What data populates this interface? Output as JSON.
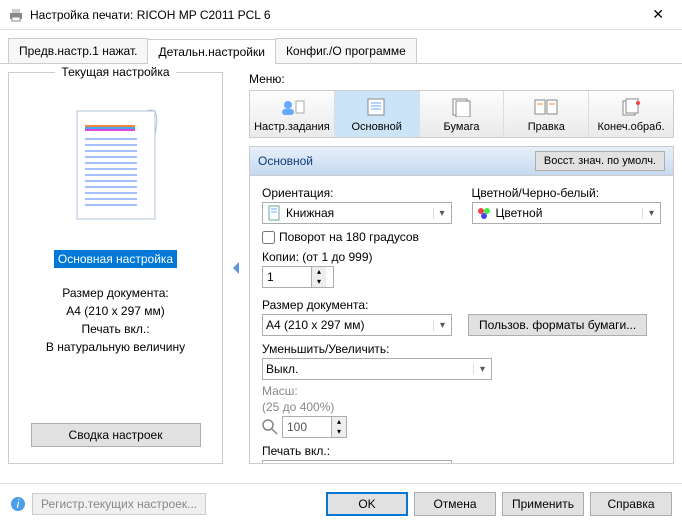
{
  "window": {
    "title": "Настройка печати: RICOH MP C2011 PCL 6"
  },
  "tabs": {
    "preset": "Предв.настр.1 нажат.",
    "detail": "Детальн.настройки",
    "config": "Конфиг./О программе"
  },
  "left": {
    "title": "Текущая настройка",
    "highlight": "Основная настройка",
    "docsize_label": "Размер документа:",
    "docsize_value": "A4 (210 x 297 мм)",
    "printon_label": "Печать вкл.:",
    "printon_value": "В натуральную величину",
    "summary_btn": "Сводка настроек"
  },
  "menu": {
    "label": "Меню:",
    "items": {
      "job": "Настр.задания",
      "basic": "Основной",
      "paper": "Бумага",
      "edit": "Правка",
      "finish": "Конеч.обраб."
    }
  },
  "section": {
    "title": "Основной",
    "reset": "Восст. знач. по умолч."
  },
  "settings": {
    "orientation_label": "Ориентация:",
    "orientation_value": "Книжная",
    "color_label": "Цветной/Черно-белый:",
    "color_value": "Цветной",
    "rotate180": "Поворот на 180 градусов",
    "copies_label": "Копии: (от 1 до 999)",
    "copies_value": "1",
    "docsize_label": "Размер документа:",
    "docsize_value": "A4 (210 x 297 мм)",
    "custom_btn": "Пользов. форматы бумаги...",
    "scale_label": "Уменьшить/Увеличить:",
    "scale_value": "Выкл.",
    "zoom_label": "Масш:",
    "zoom_range": "(25 до 400%)",
    "zoom_value": "100",
    "printon_label": "Печать вкл.:",
    "printon_value": "В натуральную величину"
  },
  "footer": {
    "register": "Регистр.текущих настроек...",
    "ok": "OK",
    "cancel": "Отмена",
    "apply": "Применить",
    "help": "Справка"
  }
}
